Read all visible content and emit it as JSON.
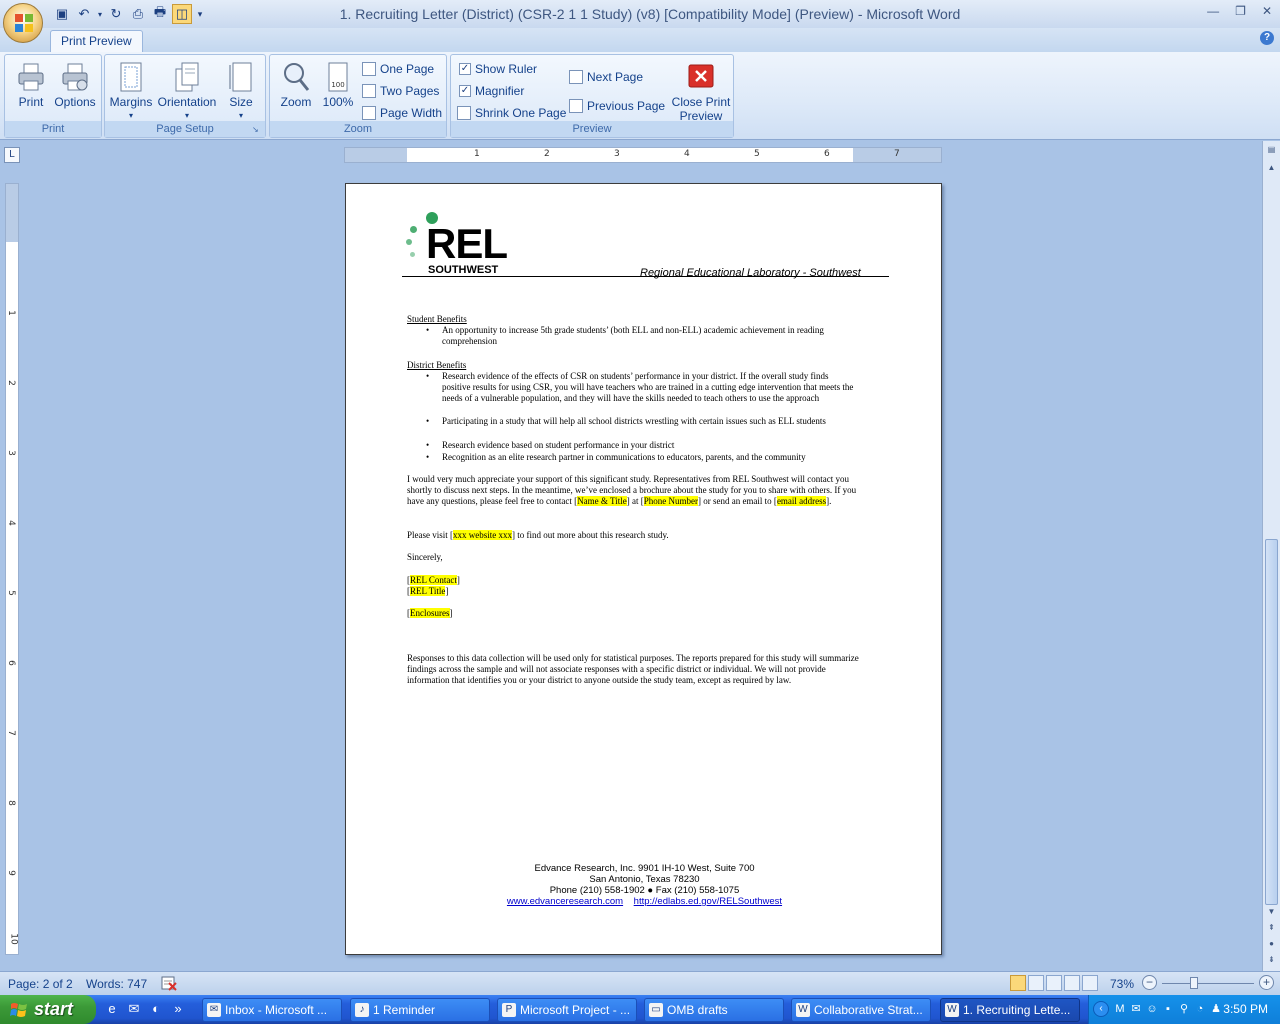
{
  "window": {
    "title": "1.  Recruiting Letter (District) (CSR-2 1 1 Study) (v8) [Compatibility Mode] (Preview) - Microsoft Word"
  },
  "ribbon": {
    "tab": "Print Preview",
    "groups": {
      "print": {
        "label": "Print",
        "buttons": [
          "Print",
          "Options"
        ]
      },
      "page_setup": {
        "label": "Page Setup",
        "buttons": [
          "Margins",
          "Orientation",
          "Size"
        ]
      },
      "zoom": {
        "label": "Zoom",
        "buttons": [
          "Zoom",
          "100%"
        ],
        "small_buttons": [
          "One Page",
          "Two Pages",
          "Page Width"
        ]
      },
      "preview": {
        "label": "Preview",
        "show_ruler": "Show Ruler",
        "magnifier": "Magnifier",
        "shrink_one_page": "Shrink One Page",
        "next_page": "Next Page",
        "previous_page": "Previous Page",
        "close_line1": "Close Print",
        "close_line2": "Preview",
        "show_ruler_checked": true,
        "magnifier_checked": true
      }
    }
  },
  "ruler": {
    "h_numbers": [
      "1",
      "2",
      "3",
      "4",
      "5",
      "6",
      "7"
    ],
    "v_numbers": [
      "1",
      "2",
      "3",
      "4",
      "5",
      "6",
      "7",
      "8",
      "9",
      "10"
    ]
  },
  "document": {
    "header_logo_text": "REL",
    "header_logo_sub": "SOUTHWEST",
    "header_subtitle": "Regional Educational Laboratory - Southwest",
    "student_benefits_heading": "Student Benefits",
    "student_benefits": [
      "An opportunity to increase 5th grade students’ (both ELL and non-ELL) academic achievement in reading comprehension"
    ],
    "district_benefits_heading": "District Benefits",
    "district_benefits": [
      "Research evidence of the effects of CSR on students’ performance in your district. If the overall study finds positive results for using CSR, you will have teachers who are trained in a cutting edge intervention that meets the needs of a vulnerable population, and they will have the skills needed to teach others to use the approach",
      "Participating in a study that will help all school districts wrestling with certain issues such as ELL students",
      "Research evidence based on student performance in your district",
      "Recognition as an elite research partner in communications to educators, parents, and the community"
    ],
    "para1_a": "I would very much appreciate  your support of this significant study. Representatives from REL Southwest will contact you shortly to discuss next steps. In the meantime, we’ve enclosed a brochure about the study for you to share with others. If you have any questions, please feel free to contact [",
    "para1_name": "Name & Title",
    "para1_b": "] at [",
    "para1_phone": "Phone Number",
    "para1_c": "] or send an email to [",
    "para1_email": "email address",
    "para1_d": "].",
    "para2_a": "Please visit [",
    "para2_site": "xxx website xxx",
    "para2_b": "] to find out more about this research study.",
    "closing": "Sincerely,",
    "rel_contact": "REL Contact",
    "rel_title": "REL Title",
    "enclosures": "Enclosures",
    "privacy": "Responses to this data collection will be used only for statistical purposes. The reports prepared for this study will summarize findings across the sample and will not associate responses with a specific district or individual.  We will not provide information that identifies you or your district to anyone outside the study team, except as required by law.",
    "footer_line1": "Edvance Research, Inc.  9901 IH-10 West, Suite 700",
    "footer_line2": "San Antonio, Texas 78230",
    "footer_line3": "Phone (210) 558-1902   ●   Fax (210) 558-1075",
    "footer_link1": "www.edvanceresearch.com",
    "footer_link2": "http://edlabs.ed.gov/RELSouthwest"
  },
  "status": {
    "page": "Page: 2 of 2",
    "words": "Words: 747",
    "zoom": "73%",
    "zoom_level_percent": 73
  },
  "taskbar": {
    "start": "start",
    "tasks": [
      "Inbox - Microsoft ...",
      "1 Reminder",
      "Microsoft Project - ...",
      "OMB drafts",
      "Collaborative Strat...",
      "1.  Recruiting Lette..."
    ],
    "clock": "3:50 PM"
  },
  "colors": {
    "accent_green": "#2fa05b",
    "highlight": "#ffff00",
    "taskbar_blue": "#245edb",
    "start_green": "#3c9a38"
  }
}
